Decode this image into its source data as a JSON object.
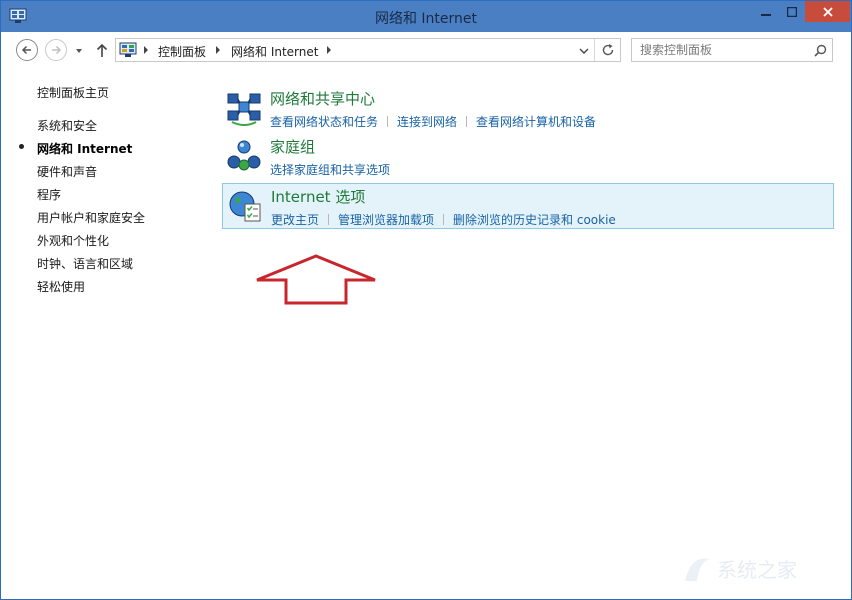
{
  "window": {
    "title": "网络和 Internet"
  },
  "address_bar": {
    "crumbs": [
      "控制面板",
      "网络和 Internet"
    ]
  },
  "search": {
    "placeholder": "搜索控制面板"
  },
  "sidebar": {
    "items": [
      {
        "label": "控制面板主页"
      },
      {
        "label": "系统和安全"
      },
      {
        "label": "网络和 Internet",
        "current": true
      },
      {
        "label": "硬件和声音"
      },
      {
        "label": "程序"
      },
      {
        "label": "用户帐户和家庭安全"
      },
      {
        "label": "外观和个性化"
      },
      {
        "label": "时钟、语言和区域"
      },
      {
        "label": "轻松使用"
      }
    ]
  },
  "categories": [
    {
      "title": "网络和共享中心",
      "icon": "network-sharing-center-icon",
      "links": [
        "查看网络状态和任务",
        "连接到网络",
        "查看网络计算机和设备"
      ]
    },
    {
      "title": "家庭组",
      "icon": "homegroup-icon",
      "links": [
        "选择家庭组和共享选项"
      ]
    },
    {
      "title": "Internet 选项",
      "icon": "internet-options-icon",
      "selected": true,
      "links": [
        "更改主页",
        "管理浏览器加载项",
        "删除浏览的历史记录和 cookie"
      ]
    }
  ],
  "annotation": {
    "arrow_color": "#c8262d"
  },
  "watermark": {
    "text": "系统之家"
  },
  "colors": {
    "titlebar": "#4a7fc4",
    "close_button": "#c74c3c",
    "category_title": "#1f7a3a",
    "link": "#1862a6",
    "selected_bg": "#e4f3fa"
  }
}
